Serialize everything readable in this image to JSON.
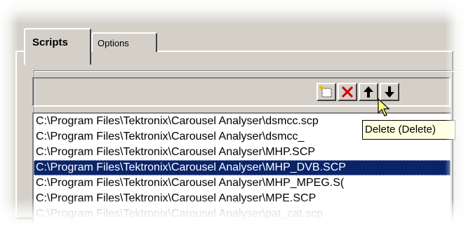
{
  "tabs": [
    {
      "label": "Scripts",
      "active": true
    },
    {
      "label": "Options",
      "active": false
    }
  ],
  "toolbar": {
    "buttons": [
      {
        "icon": "new-script-icon"
      },
      {
        "icon": "delete-x-icon",
        "color": "#cc0000"
      },
      {
        "icon": "arrow-up-icon"
      },
      {
        "icon": "arrow-down-icon"
      }
    ]
  },
  "scripts": [
    "C:\\Program Files\\Tektronix\\Carousel Analyser\\dsmcc.scp",
    "C:\\Program Files\\Tektronix\\Carousel Analyser\\dsmcc_",
    "C:\\Program Files\\Tektronix\\Carousel Analyser\\MHP.SCP",
    "C:\\Program Files\\Tektronix\\Carousel Analyser\\MHP_DVB.SCP",
    "C:\\Program Files\\Tektronix\\Carousel Analyser\\MHP_MPEG.S(",
    "C:\\Program Files\\Tektronix\\Carousel Analyser\\MPE.SCP",
    "C:\\Program Files\\Tektronix\\Carousel Analyser\\pat_cat.scp"
  ],
  "selected_index": 3,
  "tooltip": "Delete (Delete)",
  "colors": {
    "window": "#d4d0c8",
    "selection": "#0a246a",
    "tooltip_bg": "#ffffe1"
  }
}
